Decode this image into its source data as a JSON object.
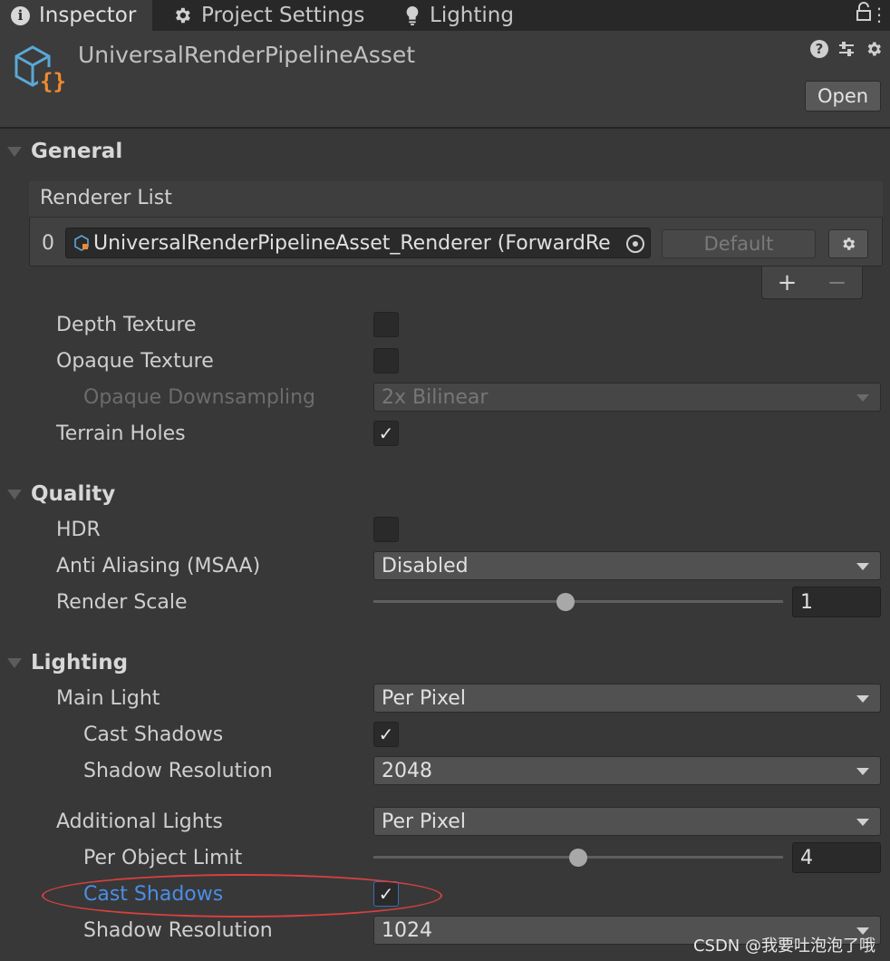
{
  "tabs": [
    {
      "label": "Inspector",
      "icon": "info-icon",
      "active": true
    },
    {
      "label": "Project Settings",
      "icon": "gear-icon",
      "active": false
    },
    {
      "label": "Lighting",
      "icon": "lightbulb-icon",
      "active": false
    }
  ],
  "header": {
    "asset_name": "UniversalRenderPipelineAsset",
    "asset_icon": "scriptable-object-icon",
    "icons": [
      "help-icon",
      "presets-icon",
      "settings-icon"
    ],
    "open_label": "Open"
  },
  "general": {
    "title": "General",
    "renderer_list": {
      "title": "Renderer List",
      "index": "0",
      "renderer": "UniversalRenderPipelineAsset_Renderer (ForwardRe",
      "default_label": "Default",
      "add": "+",
      "remove": "−"
    },
    "depth_texture": {
      "label": "Depth Texture",
      "checked": false
    },
    "opaque_texture": {
      "label": "Opaque Texture",
      "checked": false
    },
    "opaque_downsampling": {
      "label": "Opaque Downsampling",
      "value": "2x Bilinear"
    },
    "terrain_holes": {
      "label": "Terrain Holes",
      "checked": true
    }
  },
  "quality": {
    "title": "Quality",
    "hdr": {
      "label": "HDR",
      "checked": false
    },
    "msaa": {
      "label": "Anti Aliasing (MSAA)",
      "value": "Disabled"
    },
    "render_scale": {
      "label": "Render Scale",
      "value": "1",
      "fraction": 0.47
    }
  },
  "lighting": {
    "title": "Lighting",
    "main_light": {
      "label": "Main Light",
      "value": "Per Pixel"
    },
    "main_cast_shadows": {
      "label": "Cast Shadows",
      "checked": true
    },
    "main_shadow_resolution": {
      "label": "Shadow Resolution",
      "value": "2048"
    },
    "additional_lights": {
      "label": "Additional Lights",
      "value": "Per Pixel"
    },
    "per_object_limit": {
      "label": "Per Object Limit",
      "value": "4",
      "fraction": 0.5
    },
    "additional_cast_shadows": {
      "label": "Cast Shadows",
      "checked": true
    },
    "additional_shadow_resolution": {
      "label": "Shadow Resolution",
      "value": "1024"
    }
  },
  "watermark": "CSDN @我要吐泡泡了哦",
  "colors": {
    "highlight": "#4a8ee6",
    "annotation": "#d84040",
    "background": "#383838"
  }
}
